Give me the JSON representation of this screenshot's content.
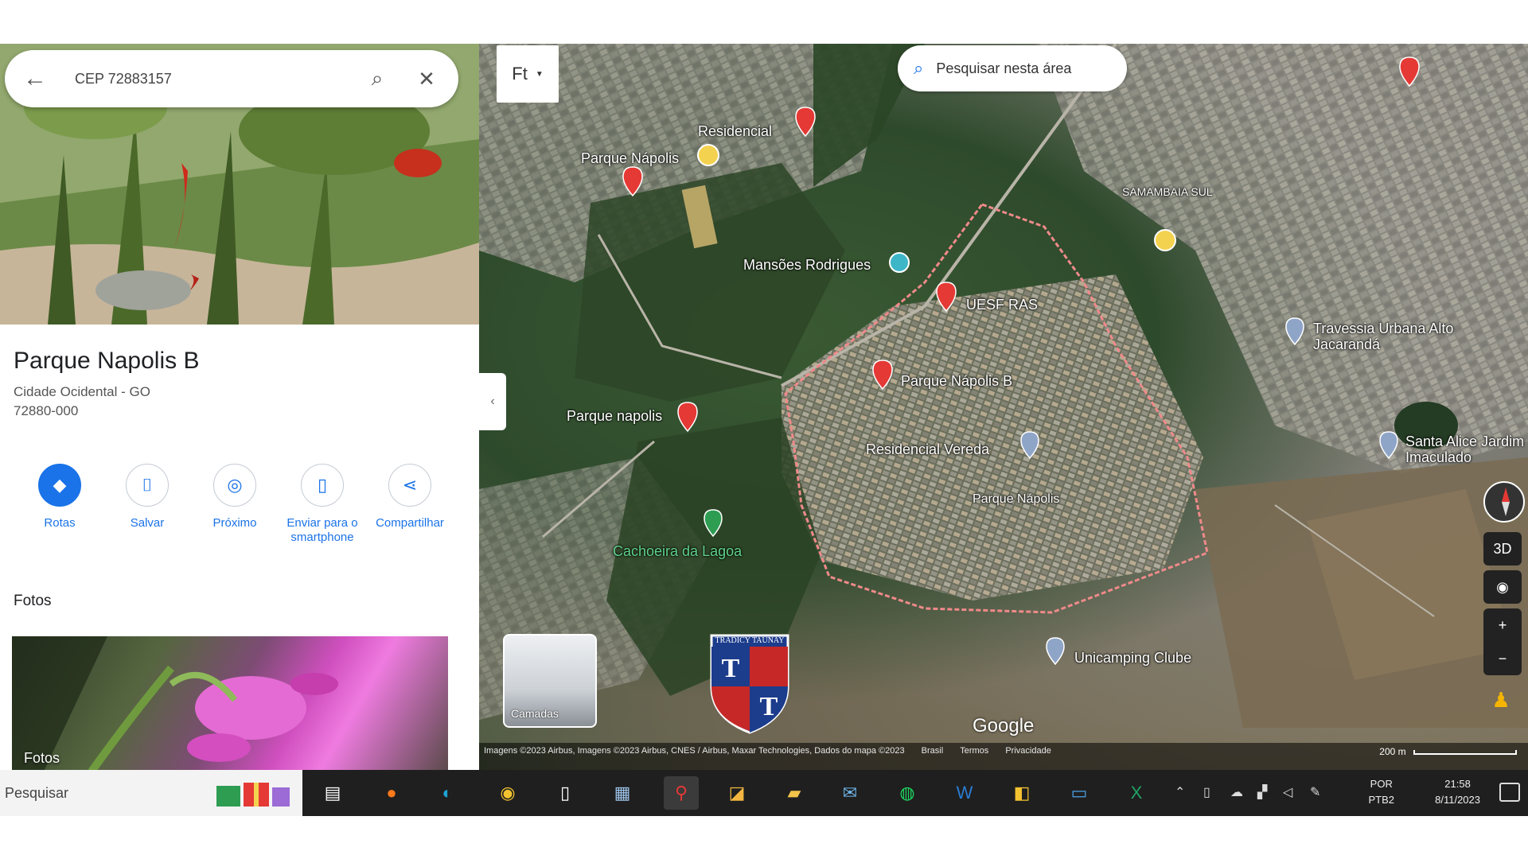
{
  "search": {
    "value": "CEP 72883157",
    "back_icon": "arrow-left-icon",
    "search_icon": "search-icon",
    "clear_icon": "close-icon"
  },
  "place": {
    "title": "Parque Napolis B",
    "city": "Cidade Ocidental - GO",
    "postal_code": "72880-000"
  },
  "actions": [
    {
      "label": "Rotas",
      "icon": "directions-icon"
    },
    {
      "label": "Salvar",
      "icon": "bookmark-icon"
    },
    {
      "label": "Próximo",
      "icon": "nearby-icon"
    },
    {
      "label": "Enviar para o smartphone",
      "icon": "send-to-phone-icon"
    },
    {
      "label": "Compartilhar",
      "icon": "share-icon"
    }
  ],
  "photos": {
    "heading": "Fotos",
    "card_label": "Fotos"
  },
  "map": {
    "layer_label": "Ft",
    "search_area_label": "Pesquisar nesta área",
    "labels": [
      {
        "text": "Residencial",
        "kind": "place"
      },
      {
        "text": "Parque Nápolis",
        "kind": "place"
      },
      {
        "text": "Mansões Rodrigues",
        "kind": "place"
      },
      {
        "text": "UESF RAS",
        "kind": "place"
      },
      {
        "text": "Parque Nápolis B",
        "kind": "place"
      },
      {
        "text": "Parque napolis",
        "kind": "place"
      },
      {
        "text": "Residencial Vereda",
        "kind": "place"
      },
      {
        "text": "Parque Nápolis",
        "kind": "place"
      },
      {
        "text": "Cachoeira da Lagoa",
        "kind": "green"
      },
      {
        "text": "Travessia Urbana Alto Jacarandá",
        "kind": "place"
      },
      {
        "text": "Santa Alice Jardim Imaculado",
        "kind": "place"
      },
      {
        "text": "Unicamping Clube",
        "kind": "place"
      },
      {
        "text": "SAMAMBAIA SUL",
        "kind": "place"
      }
    ],
    "thumbnail_label": "Camadas",
    "logo_text": "TRADICY TAUNAY",
    "logo_letters": [
      "T",
      "T"
    ],
    "google_label": "Google",
    "attribution": "Imagens ©2023 Airbus, Imagens ©2023 Airbus, CNES / Airbus, Maxar Technologies, Dados do mapa ©2023",
    "attribution_links": [
      "Brasil",
      "Termos",
      "Privacidade"
    ],
    "scale_label": "200 m",
    "controls": {
      "tilt": "3D",
      "zoom_in": "+",
      "zoom_out": "−"
    }
  },
  "taskbar": {
    "search_placeholder": "Pesquisar",
    "apps": [
      {
        "name": "task-view-icon"
      },
      {
        "name": "firefox-icon"
      },
      {
        "name": "edge-icon"
      },
      {
        "name": "chrome-icon"
      },
      {
        "name": "file-icon"
      },
      {
        "name": "calculator-icon"
      },
      {
        "name": "pin-app-icon"
      },
      {
        "name": "folder-app-icon"
      },
      {
        "name": "file-explorer-icon"
      },
      {
        "name": "mail-icon"
      },
      {
        "name": "spotify-icon"
      },
      {
        "name": "word-icon"
      },
      {
        "name": "sticky-notes-icon"
      },
      {
        "name": "photos-icon"
      },
      {
        "name": "excel-icon"
      }
    ],
    "lang_line1": "POR",
    "lang_line2": "PTB2",
    "time": "21:58",
    "date": "8/11/2023"
  }
}
